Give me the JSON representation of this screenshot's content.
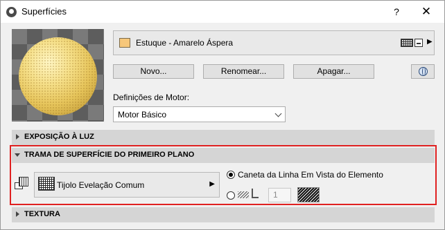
{
  "window": {
    "title": "Superfícies"
  },
  "titlebar": {
    "help_label": "?",
    "close_label": "✕"
  },
  "material": {
    "name": "Estuque - Amarelo Áspera",
    "swatch_color": "#f7c77a",
    "icons": [
      "hatch-icon",
      "texture-icon"
    ]
  },
  "buttons": {
    "new_label": "Novo...",
    "rename_label": "Renomear...",
    "delete_label": "Apagar..."
  },
  "engine": {
    "label": "Definições de Motor:",
    "selected": "Motor Básico"
  },
  "sections": {
    "exposure": "EXPOSIÇÃO À LUZ",
    "foreground": "TRAMA DE SUPERFÍCIE DO PRIMEIRO PLANO",
    "texture": "TEXTURA"
  },
  "foreground_fill": {
    "pattern_name": "Tijolo Evelação Comum",
    "option_1_label": "Caneta da Linha Em Vista do Elemento",
    "pen_number": "1"
  },
  "colors": {
    "highlight": "#e02020",
    "section_header": "#d5d5d5"
  }
}
